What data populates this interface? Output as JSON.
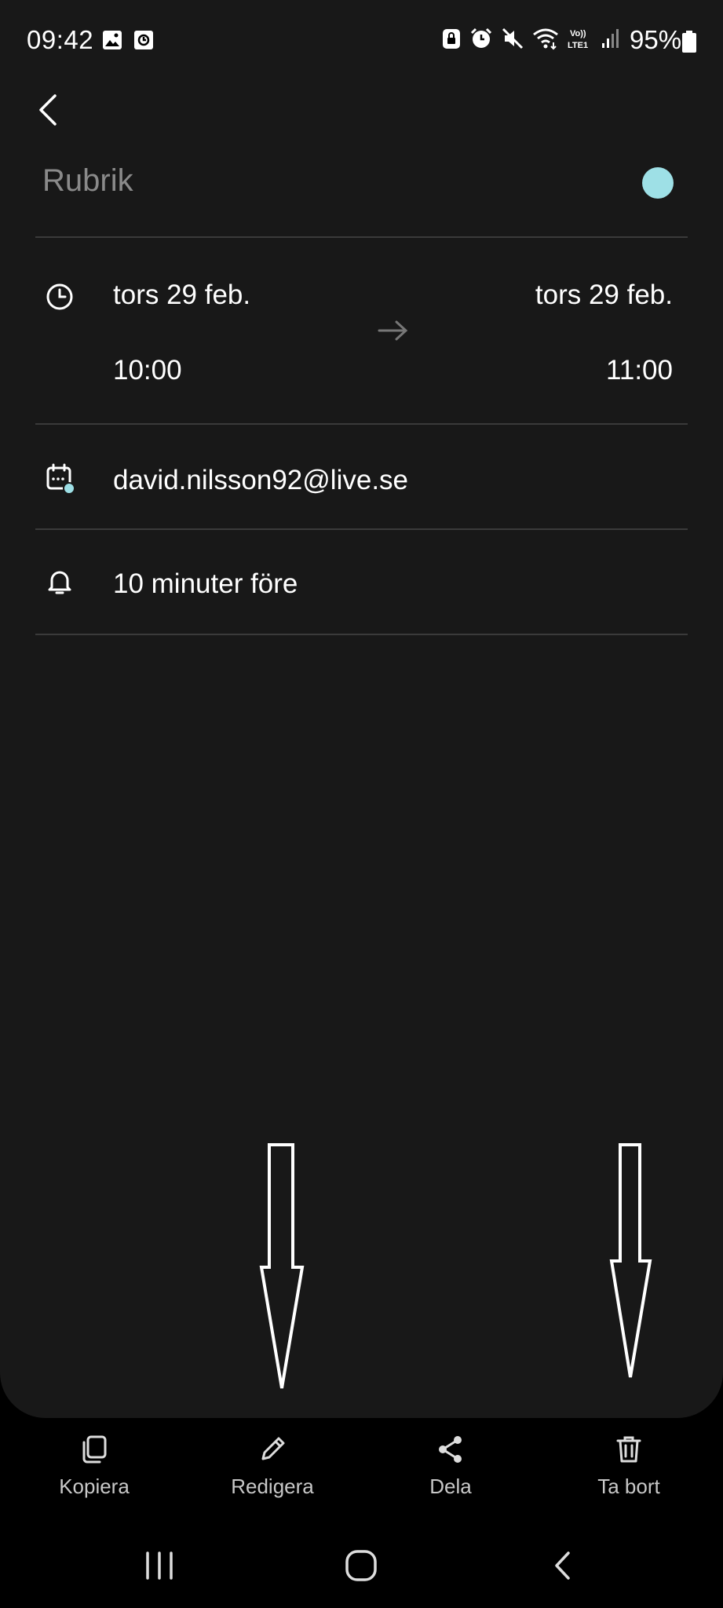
{
  "status_bar": {
    "time": "09:42",
    "battery": "95%",
    "network": "LTE1",
    "volte": "Vo))",
    "left_icons": [
      "gallery-icon",
      "screen-record-icon"
    ],
    "right_icons": [
      "lock-icon",
      "alarm-icon",
      "mute-icon",
      "wifi-icon",
      "volte-icon",
      "signal-icon",
      "battery-icon"
    ]
  },
  "event": {
    "title_placeholder": "Rubrik",
    "color": "#9ee0e6",
    "start_date": "tors 29 feb.",
    "end_date": "tors 29 feb.",
    "start_time": "10:00",
    "end_time": "11:00",
    "calendar": "david.nilsson92@live.se",
    "reminder": "10 minuter före"
  },
  "actions": {
    "copy": "Kopiera",
    "edit": "Redigera",
    "share": "Dela",
    "delete": "Ta bort"
  },
  "system_nav": [
    "recents-icon",
    "home-icon",
    "back-icon"
  ]
}
